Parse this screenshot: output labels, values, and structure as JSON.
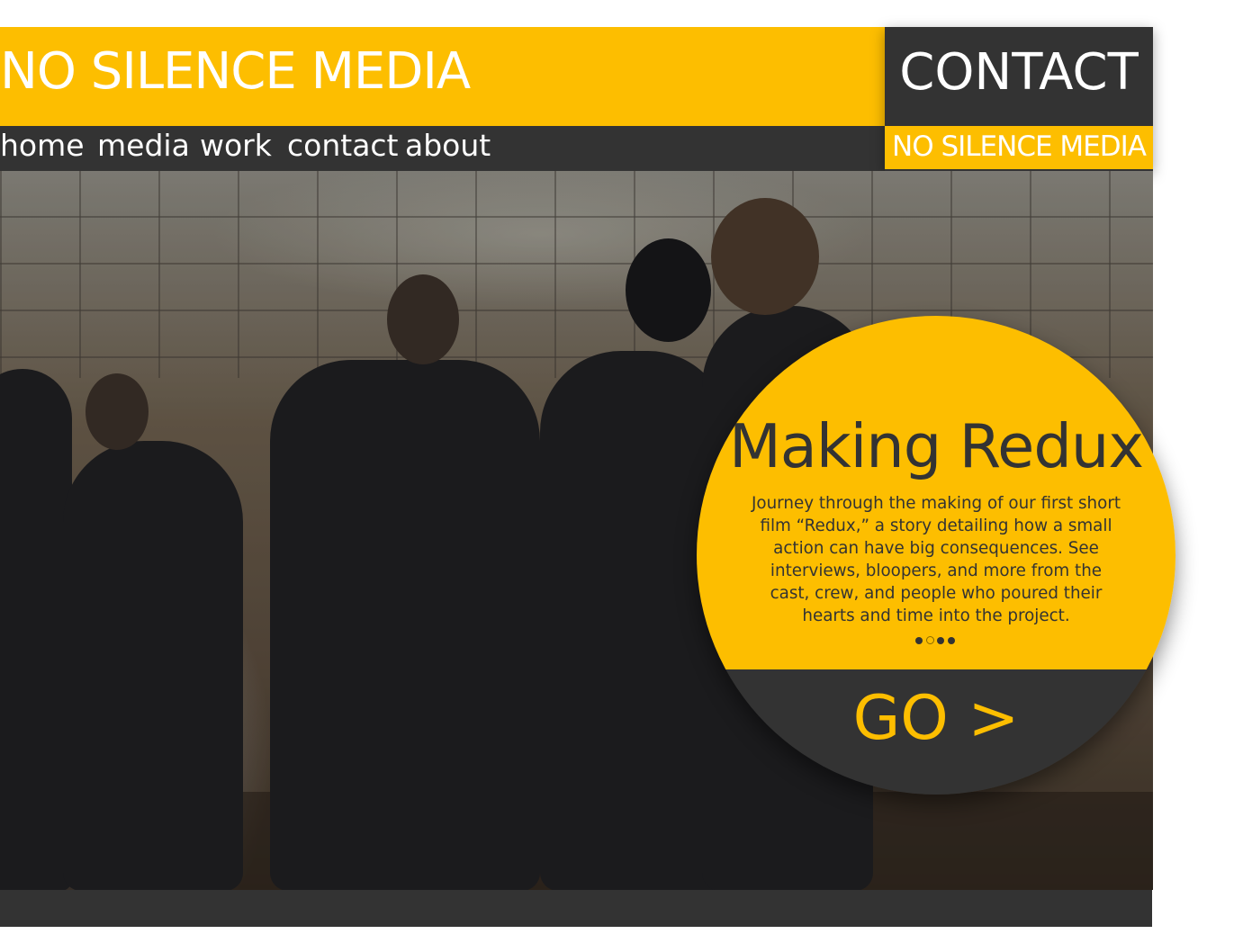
{
  "header": {
    "site_title": "NO SILENCE MEDIA"
  },
  "nav": {
    "items": [
      "home",
      "media",
      "work",
      "contact",
      "about"
    ]
  },
  "contact_panel": {
    "title": "CONTACT",
    "subtitle": "NO SILENCE MEDIA"
  },
  "feature": {
    "title": "Making Redux",
    "description": "Journey through the making of our first short film “Redux,” a story detailing how a small action can have big consequences. See interviews, bloopers, and more from the cast, crew, and people who poured their hearts and time into the project.",
    "slide_count": 4,
    "active_slide": 2,
    "go_label": "GO >"
  },
  "colors": {
    "accent": "#fdbe00",
    "dark": "#333333",
    "text_light": "#ffffff"
  }
}
